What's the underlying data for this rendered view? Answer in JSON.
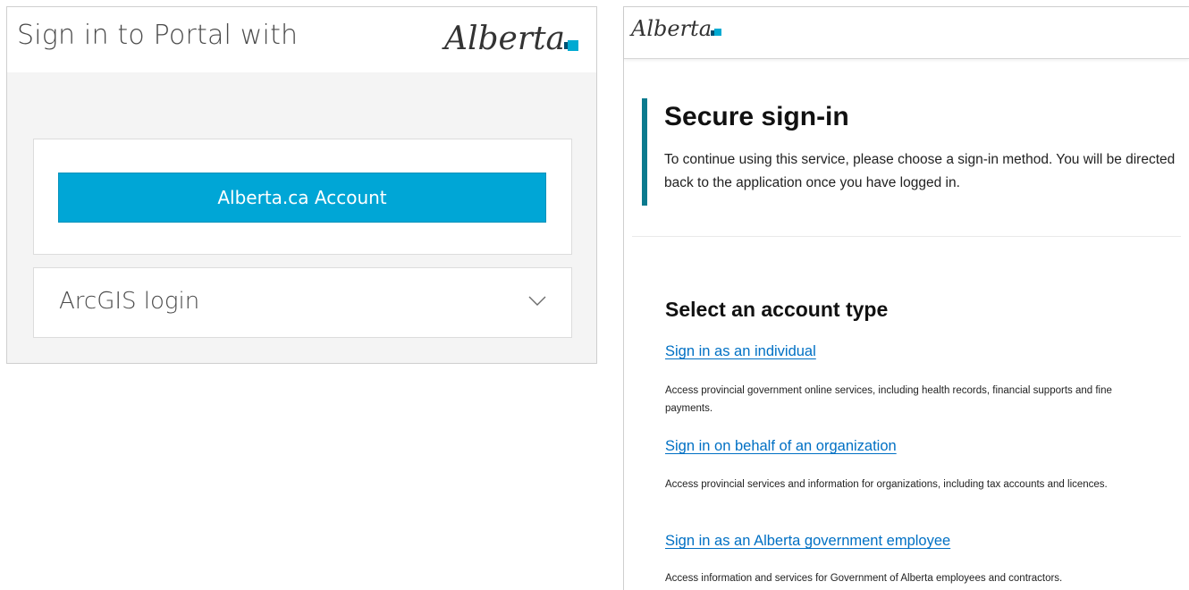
{
  "left_panel": {
    "title": "Sign in to Portal with",
    "logo_text": "Alberta",
    "alberta_account_button": "Alberta.ca Account",
    "arcgis_login_label": "ArcGIS login"
  },
  "right_panel": {
    "logo_text": "Alberta",
    "secure_title": "Secure sign-in",
    "secure_description": "To continue using this service, please choose a sign-in method. You will be directed back to the application once you have logged in.",
    "select_title": "Select an account type",
    "options": [
      {
        "link": "Sign in as an individual",
        "description": "Access provincial government online services, including health records, financial supports and fine payments."
      },
      {
        "link": "Sign in on behalf of an organization",
        "description": "Access provincial services and information for organizations, including tax accounts and licences."
      },
      {
        "link": "Sign in as an Alberta government employee",
        "description": "Access information and services for Government of Alberta employees and contractors."
      }
    ]
  },
  "colors": {
    "brand_blue": "#00a6d6",
    "callout_teal": "#0b7a8e",
    "link_blue": "#0070c4"
  },
  "icons": {
    "expand": "chevron-down-icon",
    "logo_mark": "alberta-logo-mark"
  }
}
